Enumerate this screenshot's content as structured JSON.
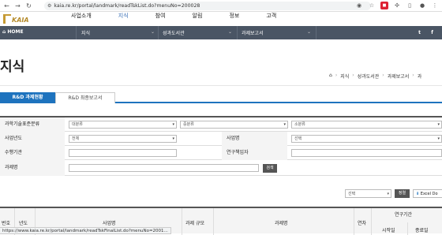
{
  "browser": {
    "url": "kaia.re.kr/portal/landmark/readTskList.do?menuNo=200028",
    "back_icon": "arrow-left-icon",
    "forward_icon": "arrow-right-icon",
    "reload_icon": "reload-icon",
    "status_url": "https://www.kaia.re.kr/portal/landmark/readTskFinalList.do?menuNo=2001..."
  },
  "logo": {
    "text": "KAIA"
  },
  "header": {
    "menu": [
      "사업소개",
      "지식",
      "참여",
      "알림",
      "정보",
      "고객"
    ]
  },
  "gnb": {
    "home": "HOME",
    "items": [
      "지식",
      "성과도서관",
      "과제보고서"
    ],
    "social": [
      "t",
      "f"
    ],
    "bg": "#4a5564"
  },
  "page": {
    "title": "지식",
    "breadcrumb": [
      "지식",
      "성과도서관",
      "과제보고서",
      "과"
    ]
  },
  "tabs": [
    "R&D 과제현황",
    "R&D 최종보고서"
  ],
  "form": {
    "row1": {
      "label": "과학기술표준분류",
      "sel1": "대분류",
      "sel2": "중분류",
      "sel3": "소분류"
    },
    "row2": {
      "label1": "사업년도",
      "sel1": "전체",
      "label2": "사업명",
      "sel2": "선택"
    },
    "row3": {
      "label1": "수행기관",
      "label2": "연구책임자"
    },
    "row4": {
      "label": "과제명",
      "search_btn": "검색"
    }
  },
  "tools": {
    "select": "선택",
    "sort_btn": "정렬",
    "excel_btn": "Excel Do"
  },
  "table": {
    "headers": [
      "번호",
      "년도",
      "사업명",
      "과제 규모",
      "과제명",
      "연차",
      "연구기간",
      "시작일",
      "종료일"
    ]
  },
  "accent": "#1e73be"
}
